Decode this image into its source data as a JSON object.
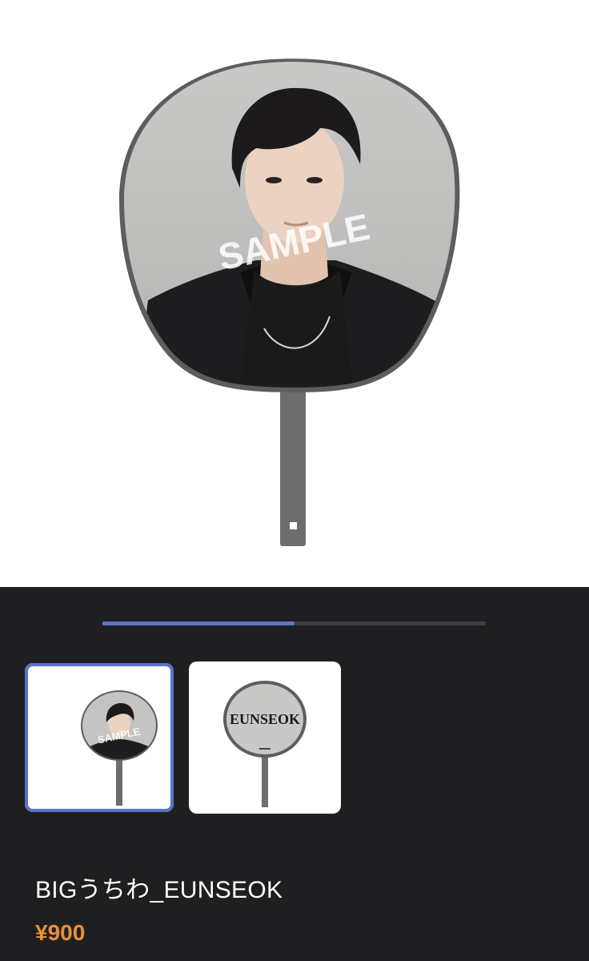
{
  "product": {
    "title": "BIGうちわ_EUNSEOK",
    "price": "¥900"
  },
  "hero": {
    "watermark": "SAMPLE"
  },
  "gallery": {
    "progress": 0.5,
    "thumbnails": [
      {
        "kind": "front",
        "watermark": "SAMPLE",
        "selected": true
      },
      {
        "kind": "back",
        "label": "EUNSEOK",
        "selected": false
      }
    ]
  },
  "colors": {
    "accent": "#5a73c9",
    "price": "#e8913a",
    "background": "#1f1f21"
  }
}
